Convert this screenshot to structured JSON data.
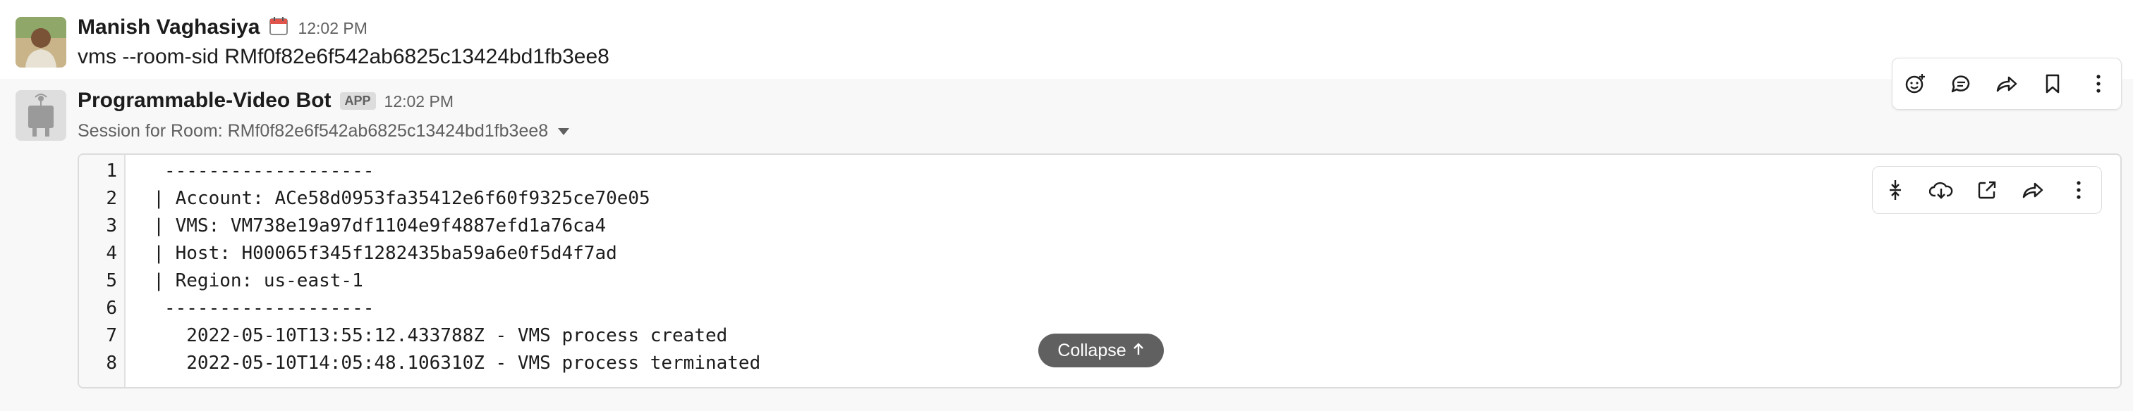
{
  "messages": [
    {
      "author": "Manish Vaghasiya",
      "status_icon": "calendar-icon",
      "time": "12:02 PM",
      "text": "vms --room-sid RMf0f82e6f542ab6825c13424bd1fb3ee8"
    },
    {
      "author": "Programmable-Video Bot",
      "badge": "APP",
      "time": "12:02 PM",
      "session_label": "Session for Room: RMf0f82e6f542ab6825c13424bd1fb3ee8",
      "snippet": {
        "line_numbers": [
          "1",
          "2",
          "3",
          "4",
          "5",
          "6",
          "7",
          "8"
        ],
        "lines": [
          "   -------------------",
          "  | Account: ACe58d0953fa35412e6f60f9325ce70e05",
          "  | VMS: VM738e19a97df1104e9f4887efd1a76ca4",
          "  | Host: H00065f345f1282435ba59a6e0f5d4f7ad",
          "  | Region: us-east-1",
          "   -------------------",
          "     2022-05-10T13:55:12.433788Z - VMS process created",
          "     2022-05-10T14:05:48.106310Z - VMS process terminated"
        ],
        "collapse_label": "Collapse"
      }
    }
  ],
  "message_actions": [
    "add-reaction-icon",
    "reply-in-thread-icon",
    "share-icon",
    "bookmark-icon",
    "more-actions-icon"
  ],
  "snippet_actions": [
    "collapse-lines-icon",
    "download-icon",
    "open-external-icon",
    "share-icon",
    "more-actions-icon"
  ],
  "colors": {
    "muted_text": "#616061",
    "hover_bg": "#f8f8f8",
    "collapse_bg": "#616061"
  }
}
